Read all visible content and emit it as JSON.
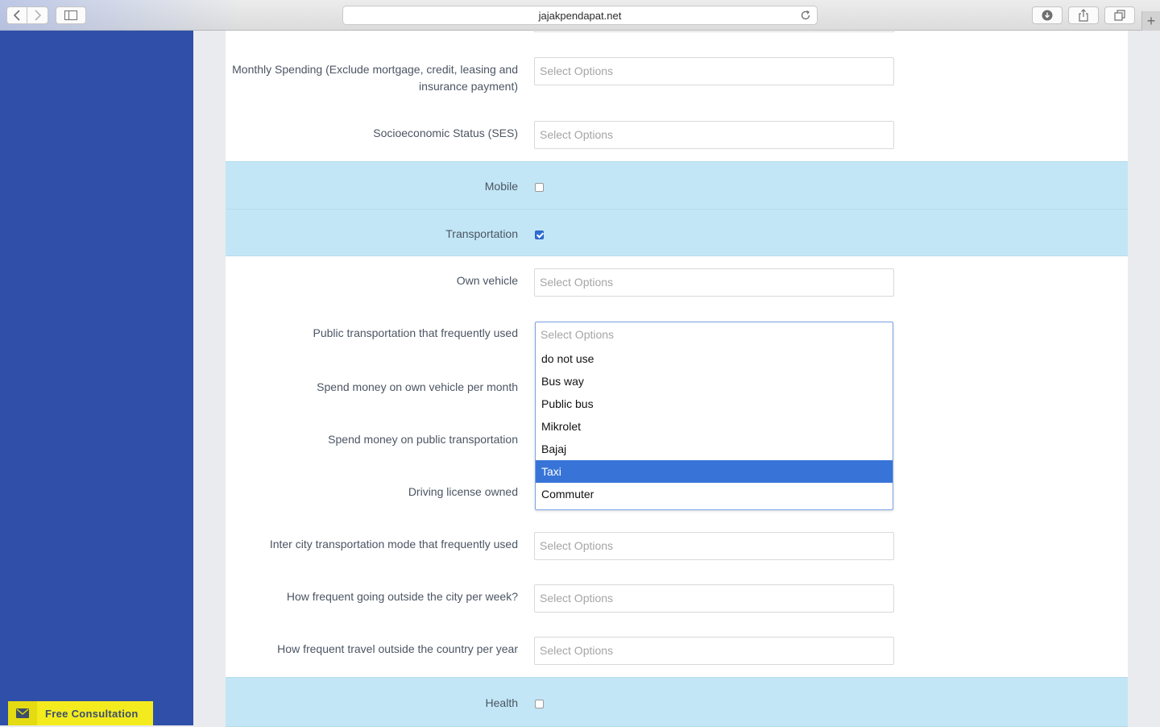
{
  "browser": {
    "url": "jajakpendapat.net"
  },
  "form": {
    "monthly_spending_label": "Monthly Spending (Exclude mortgage, credit, leasing and insurance payment)",
    "monthly_spending_placeholder": "Select Options",
    "ses_label": "Socioeconomic Status (SES)",
    "ses_placeholder": "Select Options",
    "mobile_label": "Mobile",
    "mobile_checked": false,
    "transportation_label": "Transportation",
    "transportation_checked": true,
    "own_vehicle_label": "Own vehicle",
    "own_vehicle_placeholder": "Select Options",
    "public_transport_label": "Public transportation that frequently used",
    "public_transport_placeholder": "Select Options",
    "public_transport_options": [
      "do not use",
      "Bus way",
      "Public bus",
      "Mikrolet",
      "Bajaj",
      "Taxi",
      "Commuter"
    ],
    "public_transport_highlighted": "Taxi",
    "spend_own_vehicle_label": "Spend money on own vehicle per month",
    "spend_public_label": "Spend money on public transportation",
    "driving_license_label": "Driving license owned",
    "intercity_label": "Inter city transportation mode that frequently used",
    "intercity_placeholder": "Select Options",
    "outside_city_label": "How frequent going outside the city per week?",
    "outside_city_placeholder": "Select Options",
    "outside_country_label": "How frequent travel outside the country per year",
    "outside_country_placeholder": "Select Options",
    "health_label": "Health",
    "health_checked": false
  },
  "consult": {
    "label": "Free Consultation"
  },
  "colors": {
    "left_band": "#2f4fa8",
    "section_bg": "#c2e6f5",
    "highlight": "#3874d8",
    "consult_bg": "#f4eb1f"
  }
}
